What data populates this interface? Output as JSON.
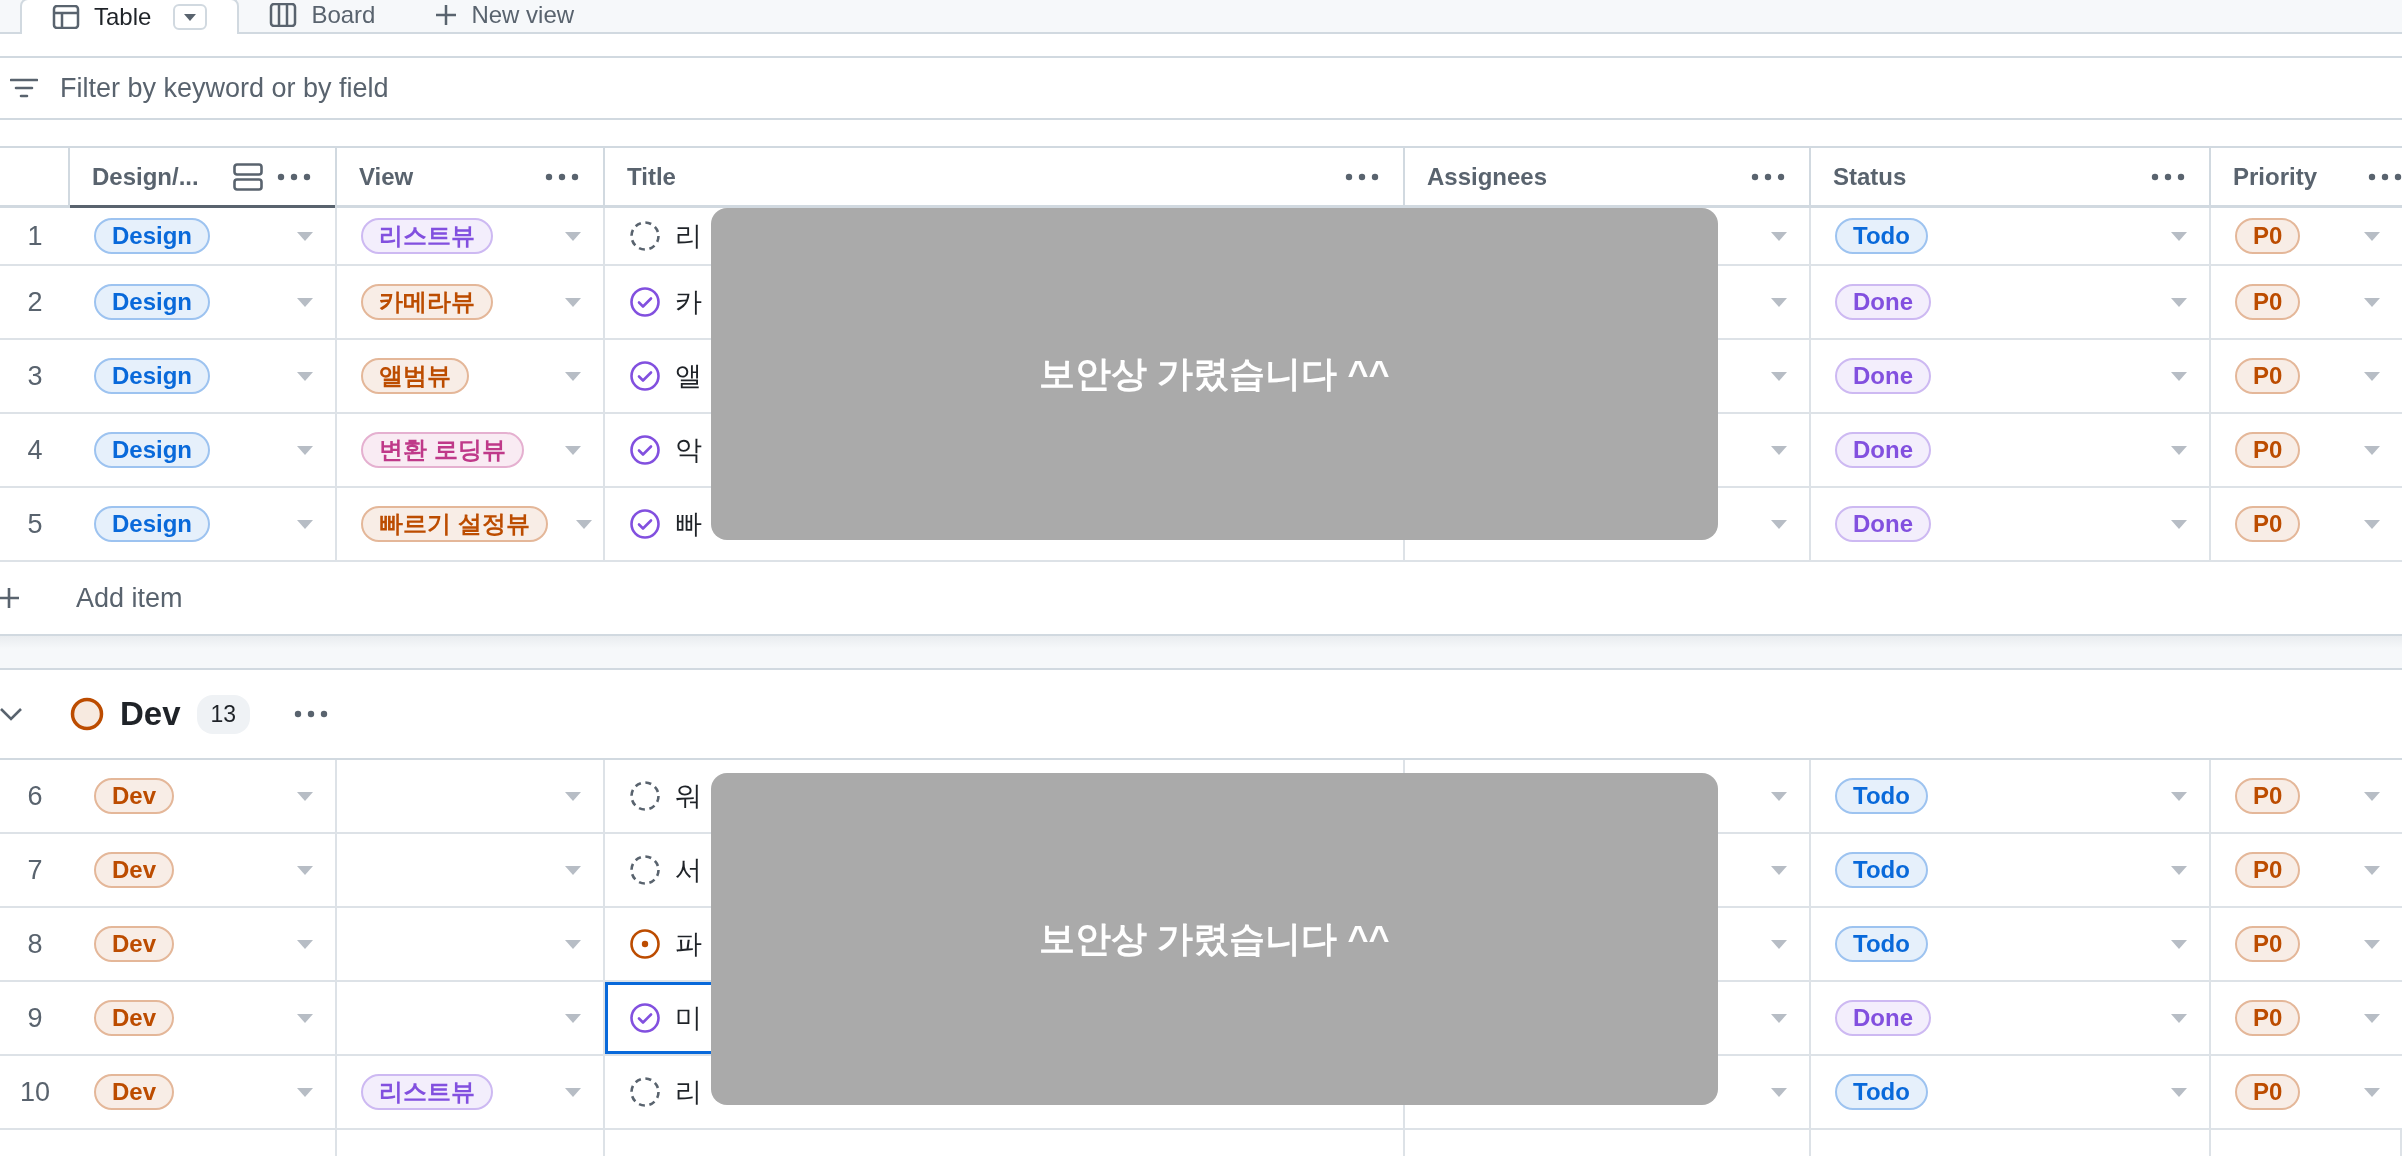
{
  "tabs": [
    {
      "label": "Table",
      "kind": "view",
      "selected": true
    },
    {
      "label": "Board",
      "kind": "board",
      "selected": false
    },
    {
      "label": "New view",
      "kind": "add",
      "selected": false
    }
  ],
  "filter": {
    "placeholder": "Filter by keyword or by field"
  },
  "columns": [
    {
      "label": "Design/...",
      "grouped": true
    },
    {
      "label": "View",
      "grouped": false
    },
    {
      "label": "Title",
      "grouped": false
    },
    {
      "label": "Assignees",
      "grouped": false
    },
    {
      "label": "Status",
      "grouped": false
    },
    {
      "label": "Priority",
      "grouped": false
    }
  ],
  "groups": [
    {
      "add_item": "Add item",
      "redaction": "보안상 가렸습니다 ^^",
      "rows": [
        {
          "number": "1",
          "selected": false,
          "type": {
            "label": "Design",
            "color": "#0969da"
          },
          "view": {
            "label": "리스트뷰",
            "color": "#8250df"
          },
          "title": {
            "text": "리",
            "kind": "draft"
          },
          "status": {
            "label": "Todo",
            "color": "#0969da"
          },
          "priority": {
            "label": "P0",
            "color": "#bc4c00"
          }
        },
        {
          "number": "2",
          "selected": false,
          "type": {
            "label": "Design",
            "color": "#0969da"
          },
          "view": {
            "label": "카메라뷰",
            "color": "#bc4c00"
          },
          "title": {
            "text": "카",
            "kind": "done"
          },
          "status": {
            "label": "Done",
            "color": "#8250df"
          },
          "priority": {
            "label": "P0",
            "color": "#bc4c00"
          }
        },
        {
          "number": "3",
          "selected": false,
          "type": {
            "label": "Design",
            "color": "#0969da"
          },
          "view": {
            "label": "앨범뷰",
            "color": "#bc4c00"
          },
          "title": {
            "text": "앨",
            "kind": "done"
          },
          "status": {
            "label": "Done",
            "color": "#8250df"
          },
          "priority": {
            "label": "P0",
            "color": "#bc4c00"
          }
        },
        {
          "number": "4",
          "selected": false,
          "type": {
            "label": "Design",
            "color": "#0969da"
          },
          "view": {
            "label": "변환 로딩뷰",
            "color": "#bf3989"
          },
          "title": {
            "text": "악",
            "kind": "done"
          },
          "status": {
            "label": "Done",
            "color": "#8250df"
          },
          "priority": {
            "label": "P0",
            "color": "#bc4c00"
          }
        },
        {
          "number": "5",
          "selected": false,
          "type": {
            "label": "Design",
            "color": "#0969da"
          },
          "view": {
            "label": "빠르기 설정뷰",
            "color": "#bc4c00"
          },
          "title": {
            "text": "빠",
            "kind": "done"
          },
          "status": {
            "label": "Done",
            "color": "#8250df"
          },
          "priority": {
            "label": "P0",
            "color": "#bc4c00"
          }
        }
      ]
    },
    {
      "name": "Dev",
      "count": "13",
      "color": "#bc4c00",
      "redaction": "보안상 가렸습니다 ^^",
      "rows": [
        {
          "number": "6",
          "selected": false,
          "type": {
            "label": "Dev",
            "color": "#bc4c00"
          },
          "title": {
            "text": "워",
            "kind": "draft"
          },
          "status": {
            "label": "Todo",
            "color": "#0969da"
          },
          "priority": {
            "label": "P0",
            "color": "#bc4c00"
          }
        },
        {
          "number": "7",
          "selected": false,
          "type": {
            "label": "Dev",
            "color": "#bc4c00"
          },
          "title": {
            "text": "서",
            "kind": "draft"
          },
          "status": {
            "label": "Todo",
            "color": "#0969da"
          },
          "priority": {
            "label": "P0",
            "color": "#bc4c00"
          }
        },
        {
          "number": "8",
          "selected": false,
          "type": {
            "label": "Dev",
            "color": "#bc4c00"
          },
          "title": {
            "text": "파",
            "kind": "in_progress"
          },
          "status": {
            "label": "Todo",
            "color": "#0969da"
          },
          "priority": {
            "label": "P0",
            "color": "#bc4c00"
          }
        },
        {
          "number": "9",
          "selected": true,
          "type": {
            "label": "Dev",
            "color": "#bc4c00"
          },
          "title": {
            "text": "미",
            "kind": "done"
          },
          "status": {
            "label": "Done",
            "color": "#8250df"
          },
          "priority": {
            "label": "P0",
            "color": "#bc4c00"
          }
        },
        {
          "number": "10",
          "selected": false,
          "type": {
            "label": "Dev",
            "color": "#bc4c00"
          },
          "view": {
            "label": "리스트뷰",
            "color": "#8250df"
          },
          "title": {
            "text": "리",
            "kind": "draft"
          },
          "status": {
            "label": "Todo",
            "color": "#0969da"
          },
          "priority": {
            "label": "P0",
            "color": "#bc4c00"
          }
        }
      ]
    }
  ]
}
